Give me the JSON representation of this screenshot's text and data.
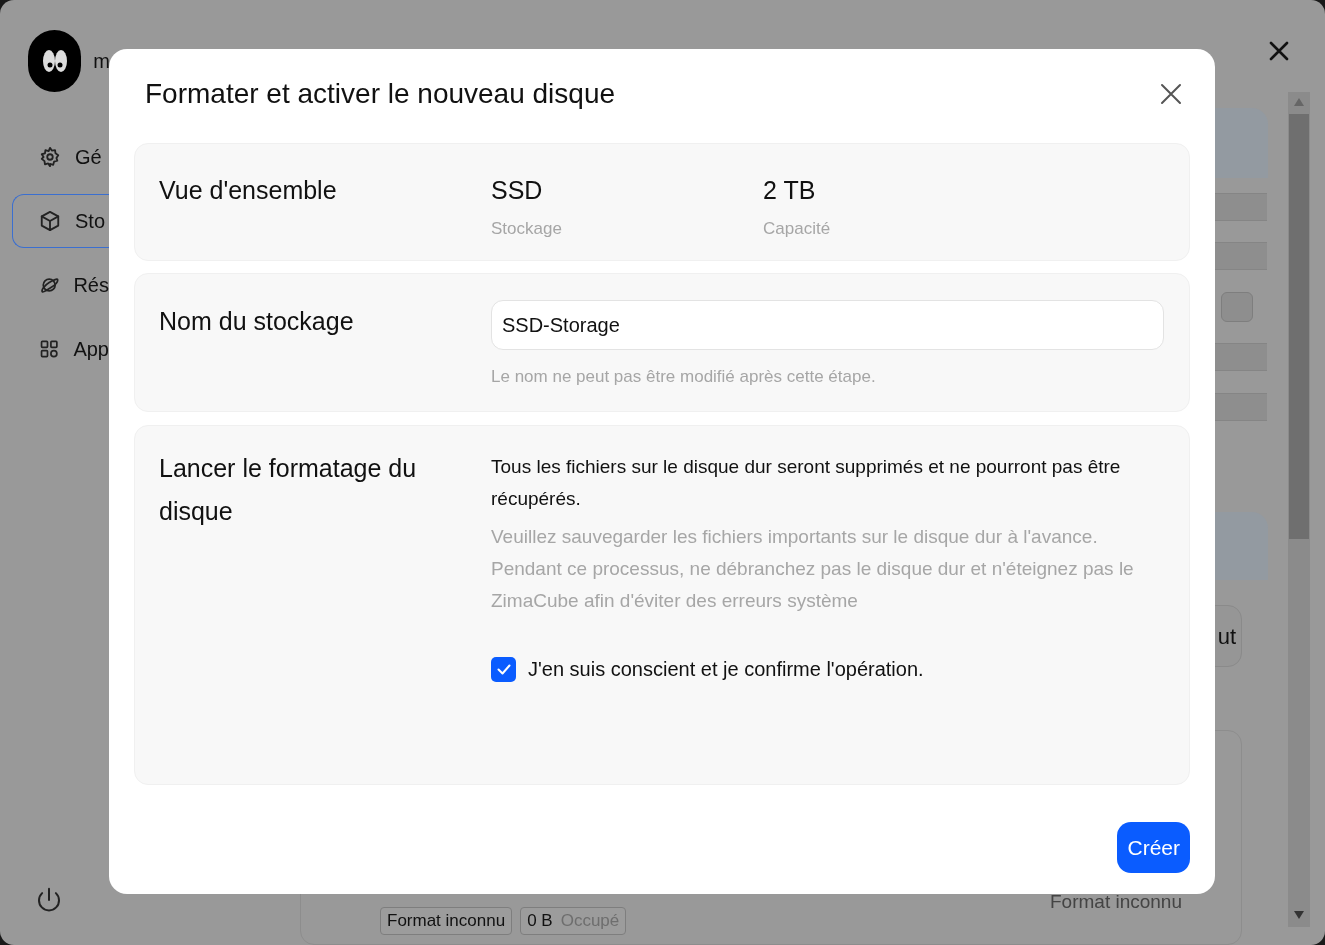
{
  "background": {
    "user_name": "m",
    "sidebar": {
      "items": [
        {
          "label": "Gé",
          "kind": "gear",
          "selected": false
        },
        {
          "label": "Sto",
          "kind": "box",
          "selected": true
        },
        {
          "label": "Rés",
          "kind": "planet",
          "selected": false
        },
        {
          "label": "App",
          "kind": "grid",
          "selected": false
        }
      ]
    },
    "side_button": "ut",
    "disk_format": "Format inconnu",
    "chips": [
      {
        "value": "Format inconnu"
      },
      {
        "value": "0 B",
        "label": "Occupé"
      }
    ]
  },
  "dialog": {
    "title": "Formater et activer le nouveau disque",
    "overview": {
      "label": "Vue d'ensemble",
      "stats": [
        {
          "value": "SSD",
          "caption": "Stockage"
        },
        {
          "value": "2 TB",
          "caption": "Capacité"
        }
      ]
    },
    "name": {
      "label": "Nom du stockage",
      "value": "SSD-Storage",
      "hint": "Le nom ne peut pas être modifié après cette étape."
    },
    "format": {
      "label": "Lancer le formatage du disque",
      "warning": "Tous les fichiers sur le disque dur seront supprimés et ne pourront pas être récupérés.",
      "note": "Veuillez sauvegarder les fichiers importants sur le disque dur à l'avance. Pendant ce processus, ne débranchez pas le disque dur et n'éteignez pas le ZimaCube afin d'éviter des erreurs système",
      "confirm": {
        "label": "J'en suis conscient et je confirme l'opération.",
        "checked": true
      }
    },
    "create_button": "Créer"
  }
}
